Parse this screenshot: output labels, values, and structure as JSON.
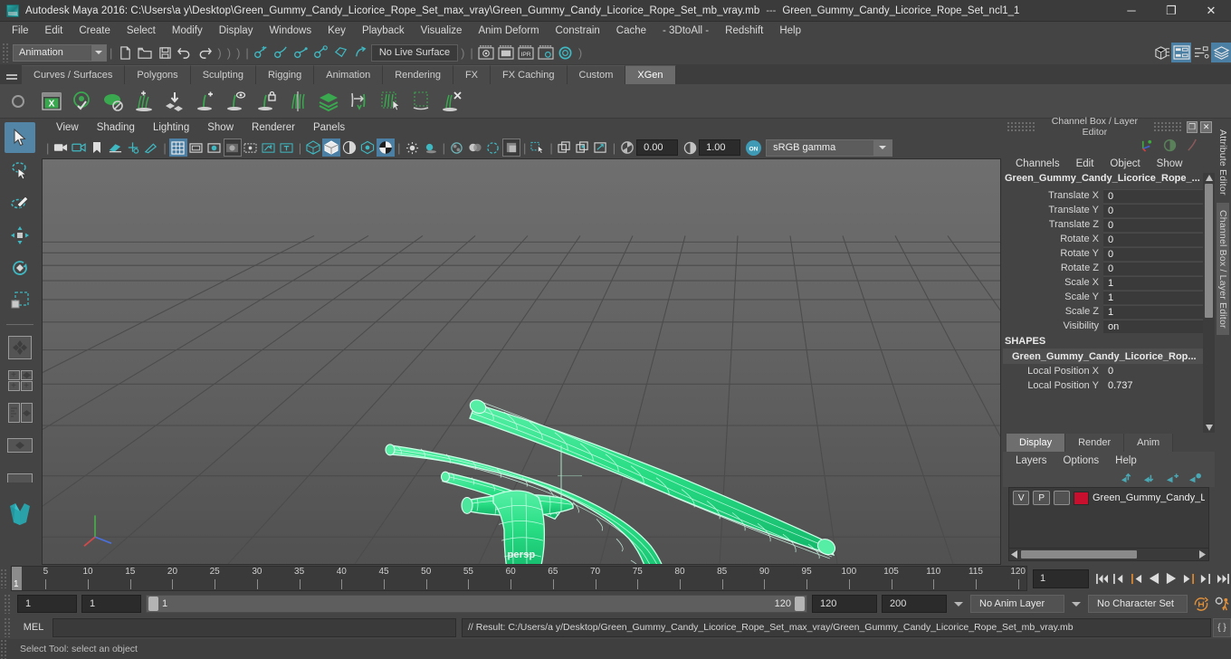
{
  "window": {
    "app_title": "Autodesk Maya 2016: C:\\Users\\a y\\Desktop\\Green_Gummy_Candy_Licorice_Rope_Set_max_vray\\Green_Gummy_Candy_Licorice_Rope_Set_mb_vray.mb",
    "separator": "---",
    "selected_node": "Green_Gummy_Candy_Licorice_Rope_Set_ncl1_1",
    "minimize": "─",
    "maximize": "❐",
    "close": "✕"
  },
  "menubar": {
    "items": [
      "File",
      "Edit",
      "Create",
      "Select",
      "Modify",
      "Display",
      "Windows",
      "Key",
      "Playback",
      "Visualize",
      "Anim Deform",
      "Constrain",
      "Cache",
      "- 3DtoAll -",
      "Redshift",
      "Help"
    ]
  },
  "statusbar": {
    "menuset": "Animation",
    "live_surface": "No Live Surface"
  },
  "shelf": {
    "tabs": [
      "Curves / Surfaces",
      "Polygons",
      "Sculpting",
      "Rigging",
      "Animation",
      "Rendering",
      "FX",
      "FX Caching",
      "Custom",
      "XGen"
    ],
    "active_tab": "XGen",
    "icons": [
      "xgen-editor-icon",
      "xgen-preview-visibility-icon",
      "xgen-preview-disable-icon",
      "xgen-add-density-icon",
      "xgen-mask-icon",
      "xgen-add-guide-icon",
      "xgen-guide-visibility-icon",
      "xgen-lock-guide-icon",
      "xgen-mirror-guide-icon",
      "xgen-density-map-icon",
      "xgen-length-tool-icon",
      "xgen-select-guide-icon",
      "xgen-region-icon",
      "xgen-delete-guide-icon"
    ]
  },
  "tools": {
    "items": [
      {
        "name": "select-tool",
        "label": "Select Tool",
        "selected": true
      },
      {
        "name": "lasso-select-tool",
        "label": "Lasso Select Tool",
        "selected": false
      },
      {
        "name": "paint-select-tool",
        "label": "Paint Select Tool",
        "selected": false
      },
      {
        "name": "move-tool",
        "label": "Move Tool",
        "selected": false
      },
      {
        "name": "rotate-tool",
        "label": "Rotate Tool",
        "selected": false
      },
      {
        "name": "scale-tool",
        "label": "Scale Tool",
        "selected": false
      }
    ]
  },
  "viewport": {
    "menus": [
      "View",
      "Shading",
      "Lighting",
      "Show",
      "Renderer",
      "Panels"
    ],
    "camera_label": "persp",
    "exposure": "0.00",
    "gamma": "1.00",
    "color_management_toggle": "ON",
    "color_profile": "sRGB gamma",
    "background_top": "#6d6d6d",
    "background_bottom": "#525252",
    "grid_color": "#4a4a4a",
    "selection_color": "#31e08c",
    "wire_color": "#bff7dc"
  },
  "channelbox": {
    "panel_title": "Channel Box / Layer Editor",
    "menus": [
      "Channels",
      "Edit",
      "Object",
      "Show"
    ],
    "object_name": "Green_Gummy_Candy_Licorice_Rope_...",
    "attributes": [
      {
        "label": "Translate X",
        "value": "0"
      },
      {
        "label": "Translate Y",
        "value": "0"
      },
      {
        "label": "Translate Z",
        "value": "0"
      },
      {
        "label": "Rotate X",
        "value": "0"
      },
      {
        "label": "Rotate Y",
        "value": "0"
      },
      {
        "label": "Rotate Z",
        "value": "0"
      },
      {
        "label": "Scale X",
        "value": "1"
      },
      {
        "label": "Scale Y",
        "value": "1"
      },
      {
        "label": "Scale Z",
        "value": "1"
      },
      {
        "label": "Visibility",
        "value": "on"
      }
    ],
    "shapes_header": "SHAPES",
    "shape_name": "Green_Gummy_Candy_Licorice_Rop...",
    "shape_attributes": [
      {
        "label": "Local Position X",
        "value": "0"
      },
      {
        "label": "Local Position Y",
        "value": "0.737"
      }
    ],
    "dock_restore": "❐",
    "dock_close": "✕"
  },
  "layer_editor": {
    "tabs": [
      "Display",
      "Render",
      "Anim"
    ],
    "active_tab": "Display",
    "menus": [
      "Layers",
      "Options",
      "Help"
    ],
    "buttons": [
      "move-layer-up-icon",
      "move-layer-down-icon",
      "create-empty-layer-icon",
      "create-layer-from-selected-icon"
    ],
    "layers": [
      {
        "visibility": "V",
        "playback": "P",
        "shading": "",
        "color": "#c8102e",
        "name": "Green_Gummy_Candy_Li"
      }
    ]
  },
  "side_tabs": [
    "Attribute Editor",
    "Channel Box / Layer Editor"
  ],
  "timeline": {
    "ticks": [
      5,
      10,
      15,
      20,
      25,
      30,
      35,
      40,
      45,
      50,
      55,
      60,
      65,
      70,
      75,
      80,
      85,
      90,
      95,
      100,
      105,
      110,
      115,
      120
    ],
    "range_start": 1,
    "range_end": 120,
    "current_frame": "1",
    "current_frame_label": "1",
    "playback_buttons": [
      "go-to-start-icon",
      "step-back-keyframe-icon",
      "step-back-frame-icon",
      "play-backwards-icon",
      "play-forwards-icon",
      "step-forward-frame-icon",
      "step-forward-keyframe-icon",
      "go-to-end-icon"
    ]
  },
  "range": {
    "anim_start": "1",
    "playback_start": "1",
    "slider_start_label": "1",
    "slider_end_label": "120",
    "playback_end": "120",
    "anim_end": "200",
    "anim_layer": "No Anim Layer",
    "character_set": "No Character Set",
    "auto_key_icon": "auto-keyframe-icon",
    "pref_icon": "animation-preferences-icon"
  },
  "command_line": {
    "language": "MEL",
    "input_value": "",
    "result_text": "// Result: C:/Users/a y/Desktop/Green_Gummy_Candy_Licorice_Rope_Set_max_vray/Green_Gummy_Candy_Licorice_Rope_Set_mb_vray.mb",
    "script_editor_icon": "{ }"
  },
  "help_line": {
    "text": "Select Tool: select an object"
  }
}
